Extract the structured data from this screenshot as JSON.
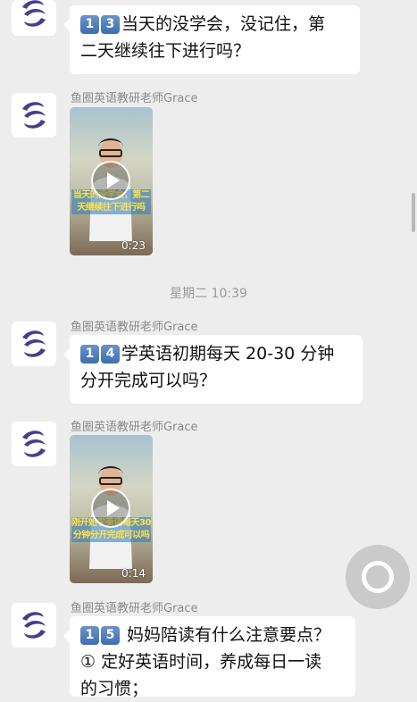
{
  "messages": [
    {
      "kind": "text",
      "keycaps": [
        "1",
        "3"
      ],
      "line1": "当天的没学会，没记住，第",
      "line2": "二天继续往下进行吗？"
    },
    {
      "kind": "video",
      "sender": "鱼圈英语教研老师Grace",
      "caption": "当天的没学会，第二天继续往下进行吗",
      "duration": "0:23"
    },
    {
      "kind": "text",
      "sender": "鱼圈英语教研老师Grace",
      "keycaps": [
        "1",
        "4"
      ],
      "line1": "学英语初期每天 20-30 分钟",
      "line2": "分开完成可以吗？"
    },
    {
      "kind": "video",
      "sender": "鱼圈英语教研老师Grace",
      "caption": "刚开始学英语每天30分钟分开完成可以吗",
      "duration": "0:14"
    },
    {
      "kind": "text",
      "sender": "鱼圈英语教研老师Grace",
      "keycaps": [
        "1",
        "5"
      ],
      "line1": " 妈妈陪读有什么注意要点？",
      "line2": "① 定好英语时间，养成每日一读",
      "line3": "的习惯；"
    }
  ],
  "timestamp": "星期二 10:39",
  "colors": {
    "background": "#ededed",
    "bubble": "#ffffff",
    "sender_text": "#8a8a8a",
    "logo": "#4a3c8c"
  },
  "icons": {
    "avatar": "fish-logo-icon",
    "play": "play-icon",
    "floating": "assistive-touch-icon"
  }
}
